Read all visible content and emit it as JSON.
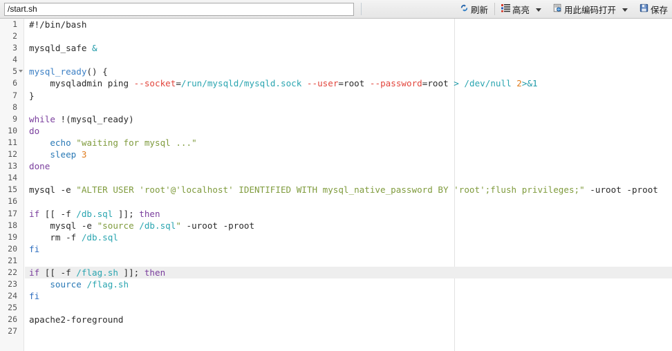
{
  "window": {
    "app_kind": "file-editor"
  },
  "path_bar": {
    "value": "/start.sh",
    "placeholder": "/start.sh"
  },
  "toolbar": {
    "refresh": {
      "label": "刷新",
      "icon": "refresh-icon"
    },
    "highlight": {
      "label": "高亮",
      "icon": "list-color-icon",
      "has_dropdown": true
    },
    "open_with_encoding": {
      "label": "用此编码打开",
      "icon": "encoding-document-icon",
      "has_dropdown": true
    },
    "save": {
      "label": "保存",
      "icon": "floppy-save-icon"
    }
  },
  "editor": {
    "language": "bash",
    "current_line": 22,
    "total_lines": 27,
    "fold_lines": [
      5
    ],
    "line_numbers": [
      1,
      2,
      3,
      4,
      5,
      6,
      7,
      8,
      9,
      10,
      11,
      12,
      13,
      14,
      15,
      16,
      17,
      18,
      19,
      20,
      21,
      22,
      23,
      24,
      25,
      26,
      27
    ],
    "lines": [
      "#!/bin/bash",
      "",
      "mysqld_safe &",
      "",
      "mysql_ready() {",
      "    mysqladmin ping --socket=/run/mysqld/mysqld.sock --user=root --password=root > /dev/null 2>&1",
      "}",
      "",
      "while !(mysql_ready)",
      "do",
      "    echo \"waiting for mysql ...\"",
      "    sleep 3",
      "done",
      "",
      "mysql -e \"ALTER USER 'root'@'localhost' IDENTIFIED WITH mysql_native_password BY 'root';flush privileges;\" -uroot -proot",
      "",
      "if [[ -f /db.sql ]]; then",
      "    mysql -e \"source /db.sql\" -uroot -proot",
      "    rm -f /db.sql",
      "fi",
      "",
      "if [[ -f /flag.sh ]]; then",
      "    source /flag.sh",
      "fi",
      "",
      "apache2-foreground",
      ""
    ]
  },
  "colors": {
    "keyword": "#7a3e9d",
    "function": "#3b7fc4",
    "builtin": "#2878b5",
    "string": "#7f9b3d",
    "number": "#e07b1c",
    "operator": "#1e9aa8",
    "flag": "#e2453c",
    "path": "#2aa5b0",
    "text": "#2b2b2b",
    "gutter_bg": "#f7f7f7",
    "current_line_bg": "#eeeeee",
    "toolbar_bg": "#ececec"
  }
}
